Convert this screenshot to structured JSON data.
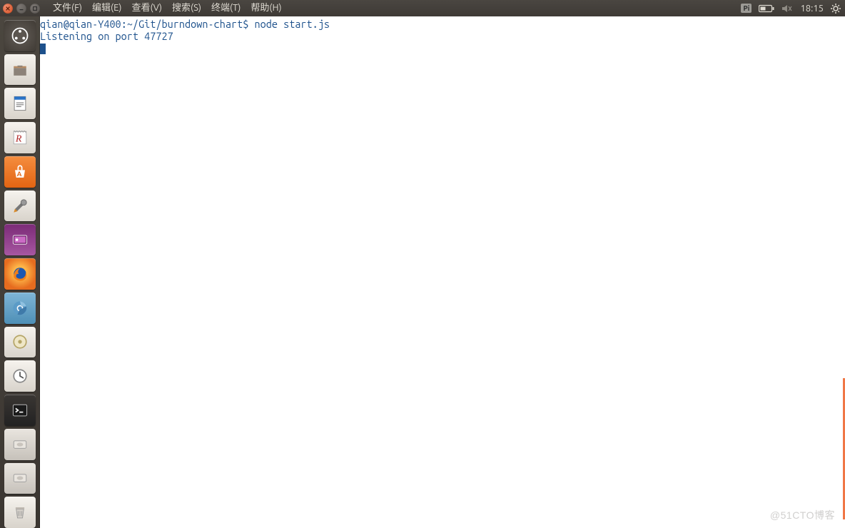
{
  "menubar": {
    "items": [
      "文件(F)",
      "编辑(E)",
      "查看(V)",
      "搜索(S)",
      "终端(T)",
      "帮助(H)"
    ]
  },
  "systray": {
    "indicator_label": "Pi",
    "clock": "18:15"
  },
  "launcher": {
    "items": [
      {
        "name": "dash-icon"
      },
      {
        "name": "files-icon"
      },
      {
        "name": "writer-icon"
      },
      {
        "name": "rnote-icon"
      },
      {
        "name": "software-center-icon"
      },
      {
        "name": "settings-icon"
      },
      {
        "name": "appearance-icon"
      },
      {
        "name": "firefox-icon"
      },
      {
        "name": "chromium-icon"
      },
      {
        "name": "rhythmbox-icon"
      },
      {
        "name": "clock-icon"
      },
      {
        "name": "terminal-icon"
      },
      {
        "name": "disk-icon"
      },
      {
        "name": "disk2-icon"
      },
      {
        "name": "trash-icon"
      }
    ]
  },
  "terminal": {
    "prompt_user_host": "qian@qian-Y400",
    "prompt_path": "~/Git/burndown-chart",
    "prompt_sep": "$",
    "command": "node start.js",
    "output_lines": [
      "Listening on port 47727"
    ]
  },
  "watermark": "@51CTO博客"
}
